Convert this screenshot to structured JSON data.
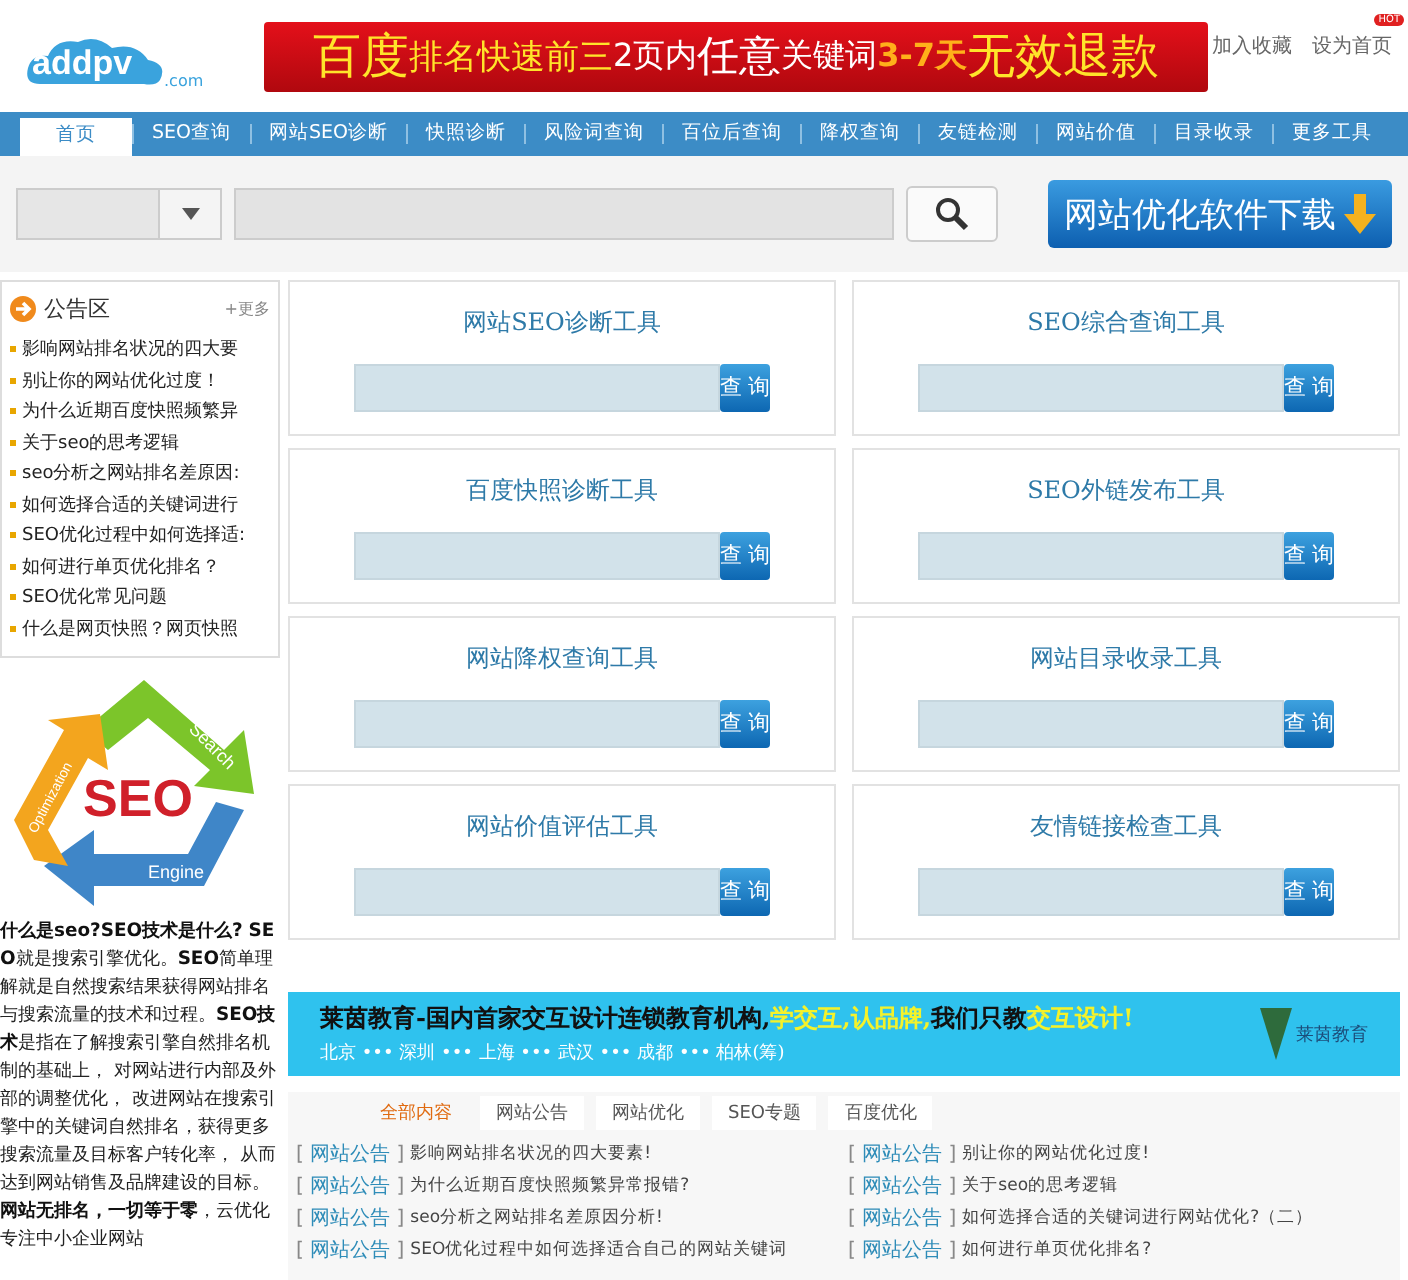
{
  "header": {
    "logo": {
      "name": "addpv",
      "suffix": ".com"
    },
    "ad": [
      {
        "text": "百度",
        "kind": "big"
      },
      {
        "text": "排名快速前三",
        "kind": "yellow"
      },
      {
        "text": " 2页内",
        "kind": "white"
      },
      {
        "text": "任意",
        "kind": "whitebig"
      },
      {
        "text": "关键词 ",
        "kind": "white"
      },
      {
        "text": "3-7天",
        "kind": "orange"
      },
      {
        "text": "无效退款",
        "kind": "big"
      }
    ],
    "links": [
      {
        "label": "加入收藏"
      },
      {
        "label": "设为首页",
        "badge": "HOT"
      }
    ]
  },
  "nav": [
    {
      "label": "首页",
      "selected": true
    },
    {
      "label": "SEO查询",
      "selected": false
    },
    {
      "label": "网站SEO诊断",
      "selected": false
    },
    {
      "label": "快照诊断",
      "selected": false
    },
    {
      "label": "风险词查询",
      "selected": false
    },
    {
      "label": "百位后查询",
      "selected": false
    },
    {
      "label": "降权查询",
      "selected": false
    },
    {
      "label": "友链检测",
      "selected": false
    },
    {
      "label": "网站价值",
      "selected": false
    },
    {
      "label": "目录收录",
      "selected": false
    },
    {
      "label": "更多工具",
      "selected": false
    }
  ],
  "download_button": "网站优化软件下载",
  "notice": {
    "title": "公告区",
    "more": "+更多",
    "items": [
      "影响网站排名状况的四大要",
      "别让你的网站优化过度！",
      "为什么近期百度快照频繁异",
      "关于seo的思考逻辑",
      "seo分析之网站排名差原因:",
      "如何选择合适的关键词进行",
      "SEO优化过程中如何选择适:",
      "如何进行单页优化排名？",
      "SEO优化常见问题",
      "什么是网页快照？网页快照"
    ]
  },
  "seo_graphic": {
    "center": "SEO",
    "labels": [
      "Search",
      "Engine",
      "Optimization"
    ]
  },
  "seo_text": "**什么是seo?SEO技术是什么?** **SEO**就是搜索引擎优化。**SEO**简单理解就是自然搜索结果获得网站排名与搜索流量的技术和过程。**SEO技术**是指在了解搜索引擎自然排名机制的基础上， 对网站进行内部及外部的调整优化， 改进网站在搜索引擎中的关键词自然排名，获得更多搜索流量及目标客户转化率， 从而达到网站销售及品牌建设的目标。**网站无排名，一切等于零**，云优化专注中小企业网站",
  "tools": [
    {
      "title": "网站SEO诊断工具",
      "button": "查 询"
    },
    {
      "title": "SEO综合查询工具",
      "button": "查 询"
    },
    {
      "title": "百度快照诊断工具",
      "button": "查 询"
    },
    {
      "title": "SEO外链发布工具",
      "button": "查 询"
    },
    {
      "title": "网站降权查询工具",
      "button": "查 询"
    },
    {
      "title": "网站目录收录工具",
      "button": "查 询"
    },
    {
      "title": "网站价值评估工具",
      "button": "查 询"
    },
    {
      "title": "友情链接检查工具",
      "button": "查 询"
    }
  ],
  "banner": {
    "headline": [
      {
        "text": "莱茵教育-国内首家交互设计连锁教育机构,",
        "kind": "plain"
      },
      {
        "text": "学交互,认品牌,",
        "kind": "highlight"
      },
      {
        "text": "我们只教",
        "kind": "plain"
      },
      {
        "text": "交互设计!",
        "kind": "highlight"
      }
    ],
    "cities": "北京 ••• 深圳 ••• 上海 ••• 武汉 ••• 成都 ••• 柏林(筹)",
    "logo": "莱茵教育"
  },
  "article_tabs": [
    {
      "label": "全部内容",
      "selected": true
    },
    {
      "label": "网站公告",
      "selected": false
    },
    {
      "label": "网站优化",
      "selected": false
    },
    {
      "label": "SEO专题",
      "selected": false
    },
    {
      "label": "百度优化",
      "selected": false
    }
  ],
  "article_brackets": [
    "[",
    "]"
  ],
  "articles": [
    {
      "category": "网站公告",
      "title": "影响网站排名状况的四大要素!"
    },
    {
      "category": "网站公告",
      "title": "别让你的网站优化过度!"
    },
    {
      "category": "网站公告",
      "title": "为什么近期百度快照频繁异常报错?"
    },
    {
      "category": "网站公告",
      "title": "关于seo的思考逻辑"
    },
    {
      "category": "网站公告",
      "title": "seo分析之网站排名差原因分析!"
    },
    {
      "category": "网站公告",
      "title": "如何选择合适的关键词进行网站优化?（二）"
    },
    {
      "category": "网站公告",
      "title": "SEO优化过程中如何选择适合自己的网站关键词"
    },
    {
      "category": "网站公告",
      "title": "如何进行单页优化排名?"
    }
  ]
}
